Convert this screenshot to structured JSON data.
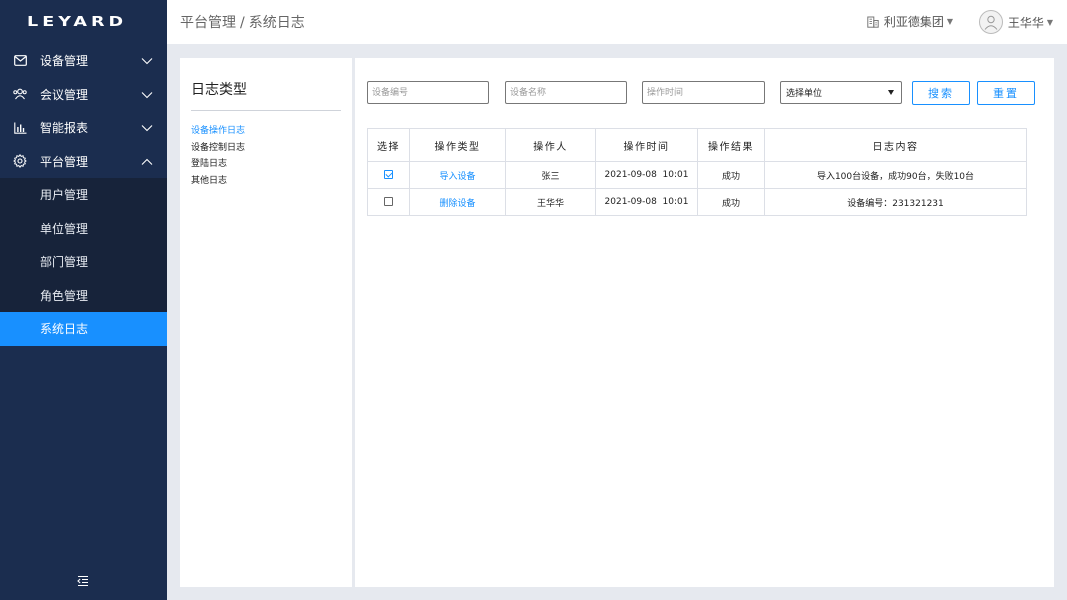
{
  "brand": {
    "logo_text": "LEYARD",
    "accent": "#1890ff",
    "sidebar_bg": "#1b2d4f"
  },
  "sidebar": {
    "items": [
      {
        "label": "设备管理",
        "icon": "envelope-check-icon",
        "expanded": false
      },
      {
        "label": "会议管理",
        "icon": "users-icon",
        "expanded": false
      },
      {
        "label": "智能报表",
        "icon": "bar-chart-icon",
        "expanded": false
      },
      {
        "label": "平台管理",
        "icon": "gear-icon",
        "expanded": true
      }
    ],
    "submenu": [
      {
        "label": "用户管理"
      },
      {
        "label": "单位管理"
      },
      {
        "label": "部门管理"
      },
      {
        "label": "角色管理"
      },
      {
        "label": "系统日志",
        "active": true
      }
    ]
  },
  "header": {
    "breadcrumb_parent": "平台管理",
    "breadcrumb_sep": "/",
    "breadcrumb_current": "系统日志",
    "org_name": "利亚德集团",
    "user_name": "王华华"
  },
  "log_types": {
    "title": "日志类型",
    "items": [
      "设备操作日志",
      "设备控制日志",
      "登陆日志",
      "其他日志"
    ],
    "active_index": 0
  },
  "filters": {
    "device_code_placeholder": "设备编号",
    "device_name_placeholder": "设备名称",
    "op_time_placeholder": "操作时间",
    "unit_select": "选择单位",
    "search_label": "搜索",
    "reset_label": "重置"
  },
  "table": {
    "headers": [
      "选择",
      "操作类型",
      "操作人",
      "操作时间",
      "操作结果",
      "日志内容"
    ],
    "rows": [
      {
        "checked": true,
        "type": "导入设备",
        "operator": "张三",
        "time": "2021-09-08  10:01",
        "result": "成功",
        "content": "导入100台设备，成功90台，失败10台"
      },
      {
        "checked": false,
        "type": "删除设备",
        "operator": "王华华",
        "time": "2021-09-08  10:01",
        "result": "成功",
        "content": "设备编号：231321231"
      }
    ]
  }
}
